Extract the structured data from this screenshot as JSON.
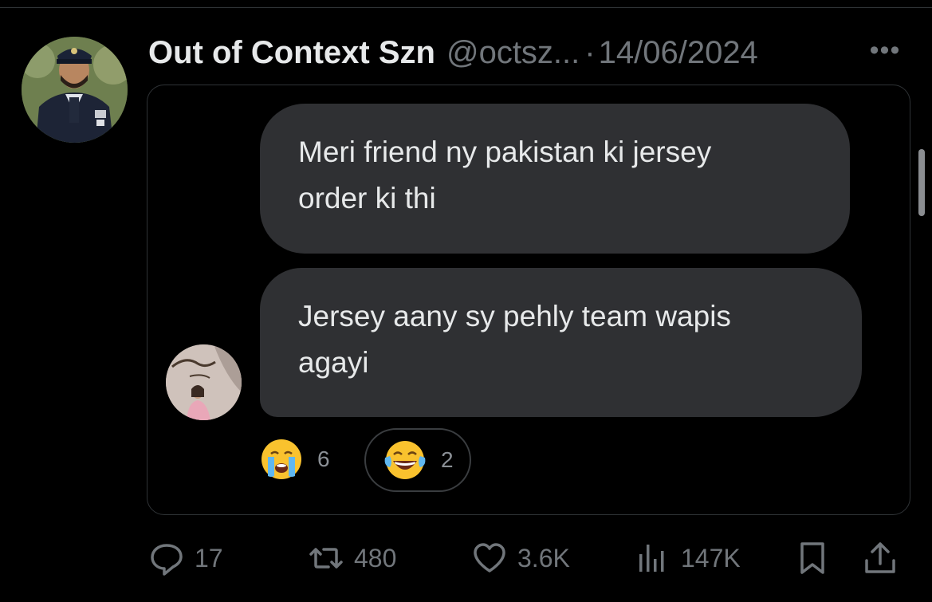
{
  "tweet": {
    "display_name": "Out of Context Szn",
    "handle": "@octsz...",
    "separator": "·",
    "date": "14/06/2024",
    "more_label": "•••"
  },
  "chat": {
    "messages": [
      {
        "text_line1": "Meri friend ny pakistan ki jersey",
        "text_line2": "order ki thi"
      },
      {
        "text_line1": "Jersey aany sy pehly team wapis",
        "text_line2": "agayi"
      }
    ],
    "reactions": [
      {
        "emoji": "crying-face-icon",
        "count": "6",
        "selected": false
      },
      {
        "emoji": "tears-of-joy-icon",
        "count": "2",
        "selected": true
      }
    ]
  },
  "actions": {
    "replies": "17",
    "reposts": "480",
    "likes": "3.6K",
    "views": "147K"
  },
  "colors": {
    "background": "#000000",
    "text": "#e7e9ea",
    "muted": "#71767b",
    "bubble": "#2f3033",
    "border": "#2f3336"
  }
}
